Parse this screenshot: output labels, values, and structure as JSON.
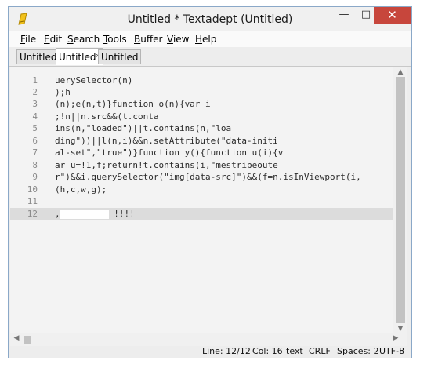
{
  "window": {
    "title": "Untitled * Textadept (Untitled)"
  },
  "menu": [
    "File",
    "Edit",
    "Search",
    "Tools",
    "Buffer",
    "View",
    "Help"
  ],
  "tabs": [
    "Untitled*",
    "Untitled*",
    "Untitled"
  ],
  "editor": {
    "lines": [
      {
        "n": "1",
        "text": "uerySelector(n)"
      },
      {
        "n": "2",
        "text": ");h"
      },
      {
        "n": "3",
        "text": "(n);e(n,t)}function o(n){var i"
      },
      {
        "n": "4",
        "text": ";!n||n.src&&(t.conta"
      },
      {
        "n": "5",
        "text": "ins(n,\"loaded\")||t.contains(n,\"loa"
      },
      {
        "n": "6",
        "text": "ding\"))||l(n,i)&&n.setAttribute(\"data-initi"
      },
      {
        "n": "7",
        "text": "al-set\",\"true\")}function y(){function u(i){v"
      },
      {
        "n": "8",
        "text": "ar u=!1,f;return!t.contains(i,\"mestripeoute"
      },
      {
        "n": "9",
        "text": "r\")&&i.querySelector(\"img[data-src]\")&&(f=n.isInViewport(i,"
      },
      {
        "n": "10",
        "text": "(h,c,w,g);"
      },
      {
        "n": "11",
        "text": ""
      },
      {
        "n": "12",
        "prefix": ",",
        "suffix": " !!!!"
      }
    ],
    "current_line": 12
  },
  "status": {
    "line": "Line: 12/12",
    "col": "Col: 16",
    "lexer": "text",
    "eol": "CRLF",
    "indent": "Spaces: 2",
    "encoding": "UTF-8"
  }
}
